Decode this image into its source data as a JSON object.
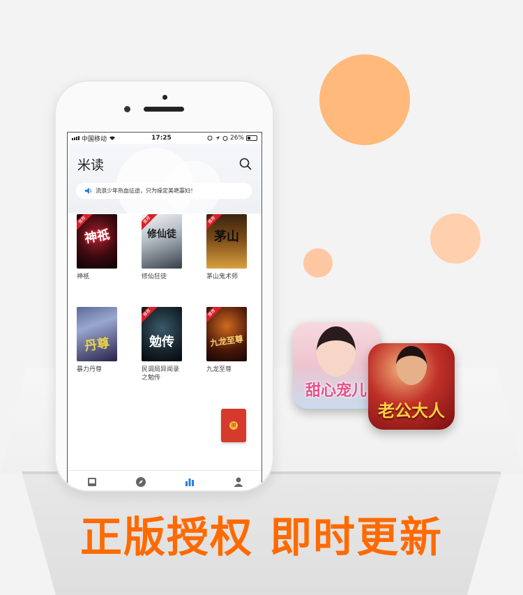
{
  "colors": {
    "accent": "#ff6a00",
    "tab_active": "#2a7be8",
    "badge": "#d8202a"
  },
  "status_bar": {
    "carrier": "中国移动",
    "time": "17:25",
    "battery": "26%"
  },
  "app": {
    "title": "米读"
  },
  "notice": {
    "text": "流浪少年热血征途，只为缘定美艳寡妇！"
  },
  "books": [
    {
      "title": "神祇",
      "cover_text": "神祇",
      "badge": "推荐"
    },
    {
      "title": "修仙狂徒",
      "cover_text": "修仙徒",
      "badge": "推荐"
    },
    {
      "title": "茅山鬼术师",
      "cover_text": "茅山",
      "badge": "推荐"
    },
    {
      "title": "暴力丹尊",
      "cover_text": "丹尊",
      "badge": ""
    },
    {
      "title": "民调局异闻录之勉传",
      "cover_text": "勉传",
      "badge": "推荐"
    },
    {
      "title": "九龙至尊",
      "cover_text": "九龙至尊",
      "badge": "推荐"
    }
  ],
  "redpack": {
    "seal": "開"
  },
  "tabs": [
    {
      "icon": "bookshelf-icon"
    },
    {
      "icon": "compass-icon"
    },
    {
      "icon": "chart-icon",
      "active": true
    },
    {
      "icon": "user-icon"
    }
  ],
  "promo_apps": [
    {
      "text": "甜心宠儿"
    },
    {
      "text": "老公大人"
    }
  ],
  "slogan": {
    "part1": "正版授权",
    "part2": "即时更新"
  }
}
